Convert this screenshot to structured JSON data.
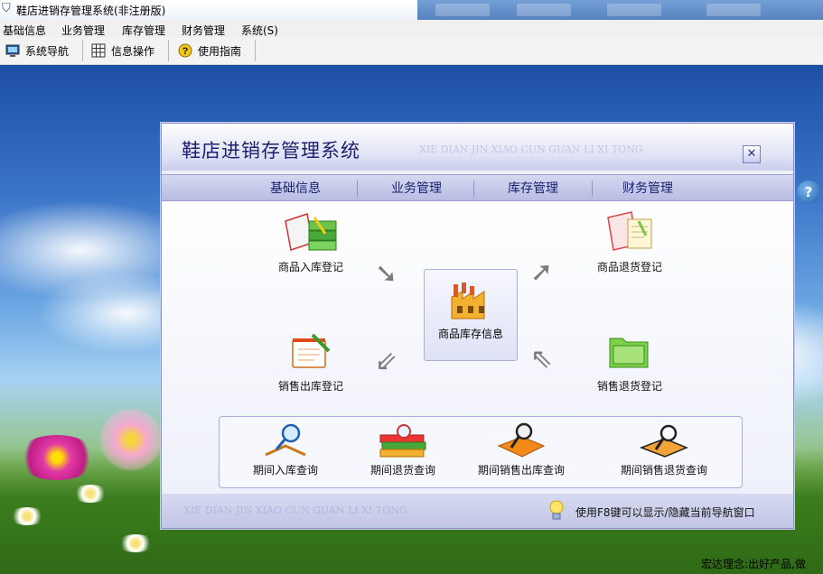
{
  "window": {
    "title": "鞋店进销存管理系统(非注册版)",
    "icon": "app-icon"
  },
  "menu": [
    "基础信息",
    "业务管理",
    "库存管理",
    "财务管理",
    "系统(S)"
  ],
  "toolbar": [
    {
      "label": "系统导航",
      "icon": "monitor-icon"
    },
    {
      "label": "信息操作",
      "icon": "grid-icon"
    },
    {
      "label": "使用指南",
      "icon": "help-icon"
    }
  ],
  "panel": {
    "title": "鞋店进销存管理系统",
    "watermark": "XIE DIAN JIN XIAO CUN GUAN LI XI TONG",
    "close_icon": "close-icon",
    "tabs": [
      "基础信息",
      "业务管理",
      "库存管理",
      "财务管理"
    ],
    "active_tab": "业务管理",
    "nodes": {
      "stock_in": "商品入库登记",
      "return_in": "商品退货登记",
      "inventory": "商品库存信息",
      "sale_out": "销售出库登记",
      "sale_return": "销售退货登记"
    },
    "queries": [
      "期间入库查询",
      "期间退货查询",
      "期间销售出库查询",
      "期间销售退货查询"
    ],
    "footer_watermark": "XIE DIAN JIN XIAO CUN GUAN LI XI TONG",
    "footer_hint": "使用F8键可以显示/隐藏当前导航窗口"
  },
  "desktop": {
    "bottom_text": "宏达理念:出好产品,做"
  },
  "colors": {
    "accent": "#1c1f6b",
    "tab_active": "#1a2170",
    "panel_bg": "#eceef9"
  }
}
